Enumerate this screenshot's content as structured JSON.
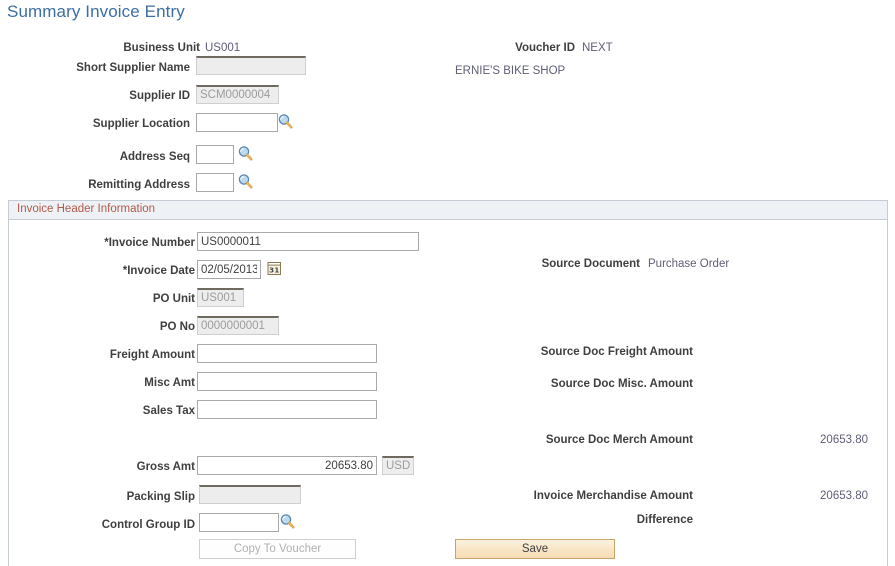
{
  "page": {
    "title": "Summary Invoice Entry"
  },
  "colors": {
    "title": "#3c6ea5",
    "group_header_text": "#b15b4a",
    "group_header_bg": "#eef1f5",
    "save_button_bg": "#f8e5c6",
    "save_button_border": "#c8a46a"
  },
  "header_section": {
    "business_unit": {
      "label": "Business Unit",
      "value": "US001"
    },
    "short_supplier_name": {
      "label": "Short Supplier Name",
      "value": "",
      "disabled": true
    },
    "supplier_id": {
      "label": "Supplier ID",
      "value": "SCM0000004",
      "disabled": true
    },
    "supplier_location": {
      "label": "Supplier Location",
      "value": "",
      "lookup_icon": "magnifier-icon"
    },
    "address_seq": {
      "label": "Address Seq",
      "value": "",
      "lookup_icon": "magnifier-icon"
    },
    "remitting_address": {
      "label": "Remitting Address",
      "value": "",
      "lookup_icon": "magnifier-icon"
    },
    "voucher_id": {
      "label": "Voucher ID",
      "value": "NEXT"
    },
    "supplier_name": "ERNIE'S BIKE SHOP"
  },
  "invoice_header": {
    "group_label": "Invoice Header Information",
    "invoice_number": {
      "label": "*Invoice Number",
      "value": "US0000011"
    },
    "invoice_date": {
      "label": "*Invoice Date",
      "value": "02/05/2013",
      "calendar_icon": "calendar-icon"
    },
    "po_unit": {
      "label": "PO Unit",
      "value": "US001",
      "disabled": true
    },
    "po_no": {
      "label": "PO No",
      "value": "0000000001",
      "disabled": true
    },
    "freight_amount": {
      "label": "Freight Amount",
      "value": ""
    },
    "misc_amt": {
      "label": "Misc Amt",
      "value": ""
    },
    "sales_tax": {
      "label": "Sales Tax",
      "value": ""
    },
    "gross_amt": {
      "label": "Gross Amt",
      "value": "20653.80"
    },
    "currency": {
      "value": "USD",
      "disabled": true
    },
    "packing_slip": {
      "label": "Packing Slip",
      "value": "",
      "disabled": true
    },
    "control_group_id": {
      "label": "Control Group ID",
      "value": "",
      "lookup_icon": "magnifier-icon"
    },
    "source_document": {
      "label": "Source Document",
      "value": "Purchase Order"
    },
    "source_doc_freight_amount": {
      "label": "Source Doc Freight Amount",
      "value": ""
    },
    "source_doc_misc_amount": {
      "label": "Source Doc Misc. Amount",
      "value": ""
    },
    "source_doc_merch_amount": {
      "label": "Source Doc Merch Amount",
      "value": "20653.80"
    },
    "invoice_merchandise_amount": {
      "label": "Invoice Merchandise Amount",
      "value": "20653.80"
    },
    "difference": {
      "label": "Difference",
      "value": ""
    }
  },
  "buttons": {
    "copy_to_voucher": "Copy To Voucher",
    "save": "Save"
  }
}
